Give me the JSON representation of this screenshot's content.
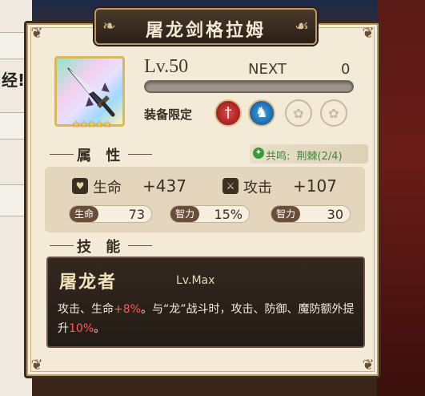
{
  "background": {
    "left_text": "经!"
  },
  "panel": {
    "title": "屠龙剑格拉姆",
    "level_label": "Lv.50",
    "next_label": "NEXT",
    "next_value": "0",
    "exp_progress": 0,
    "stars": "★★★★★",
    "equip_label": "装备限定",
    "equip_slots": [
      "sword-slot",
      "horse-slot",
      "empty-slot",
      "empty-slot"
    ]
  },
  "attributes": {
    "header": "属 性",
    "resonance_label": "共鸣:",
    "resonance_value": "荆棘(2/4)",
    "life_label": "生命",
    "life_value": "+437",
    "attack_label": "攻击",
    "attack_value": "+107",
    "pills": [
      {
        "label": "生命",
        "value": "73"
      },
      {
        "label": "智力",
        "value": "15%"
      },
      {
        "label": "智力",
        "value": "30"
      }
    ]
  },
  "skills": {
    "header": "技 能",
    "skill_name": "屠龙者",
    "skill_level": "Lv.Max",
    "desc_part1": "攻击、生命",
    "desc_hl1": "+8%",
    "desc_part2": "。与“龙”战斗时，攻击、防御、魔防额外提升",
    "desc_hl2": "10%",
    "desc_part3": "。"
  },
  "colors": {
    "panel_bg": "#f3ead8",
    "title_bg": "#2b1f17",
    "highlight": "#ff5a5a",
    "resonance": "#3b8a3b"
  }
}
